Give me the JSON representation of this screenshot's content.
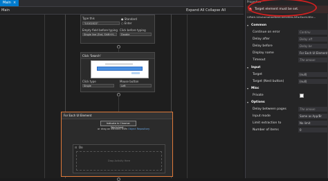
{
  "tab": {
    "label": "Main",
    "close": "×"
  },
  "breadcrumb": {
    "path": "Main",
    "expand_all": "Expand All",
    "collapse_all": "Collapse All"
  },
  "type_into": {
    "type_this_label": "Type this",
    "type_this_value": "\"10102022\"",
    "radio_standard": "Standard",
    "radio_enter": "Enter",
    "empty_field_label": "Empty field before typing",
    "empty_field_value": "Single line (End, Shift+H...",
    "click_before_label": "Click before typing",
    "click_before_value": "Double"
  },
  "click": {
    "title": "Click 'Search'",
    "click_type_label": "Click type",
    "click_type_value": "Single",
    "mouse_button_label": "Mouse button",
    "mouse_button_value": "Left"
  },
  "foreach": {
    "title": "For Each UI Element",
    "indicate_button": "Indicate in Chrome: Worksheet...",
    "or_text": "or drag an element from",
    "object_repo": "Object Repository",
    "do_label": "Do",
    "drop_text": "Drop Activity Here"
  },
  "properties": {
    "title": "Properties",
    "error": "Target element must be set.",
    "type_name": "UiPath.UIAutomationNext.Activities.NForEachUiEle...",
    "sections": {
      "common": "Common",
      "input": "Input",
      "misc": "Misc",
      "options": "Options"
    },
    "common_rows": [
      {
        "key": "Continue on error",
        "value": "Continu",
        "italic": true
      },
      {
        "key": "Delay after",
        "value": "Delay aft",
        "italic": true
      },
      {
        "key": "Delay before",
        "value": "Delay be",
        "italic": true
      },
      {
        "key": "Display name",
        "value": "For Each UI Element",
        "italic": false
      },
      {
        "key": "Timeout",
        "value": "The amoun",
        "italic": true
      }
    ],
    "input_rows": [
      {
        "key": "Target",
        "value": "(null)"
      },
      {
        "key": "Target (Nest button)",
        "value": "(null)"
      }
    ],
    "misc_rows": [
      {
        "key": "Private",
        "value": ""
      }
    ],
    "options_rows": [
      {
        "key": "Delay between pages",
        "value": "The amoun",
        "italic": true
      },
      {
        "key": "Input mode",
        "value": "Same as App/Br",
        "italic": false
      },
      {
        "key": "Limit extraction to",
        "value": "No limit",
        "italic": false
      },
      {
        "key": "Number of items",
        "value": "0",
        "italic": false
      }
    ],
    "colors": {
      "error": "#e04040",
      "highlight": "#d02020",
      "accent": "#007acc",
      "selected_border": "#e07a3a"
    }
  }
}
